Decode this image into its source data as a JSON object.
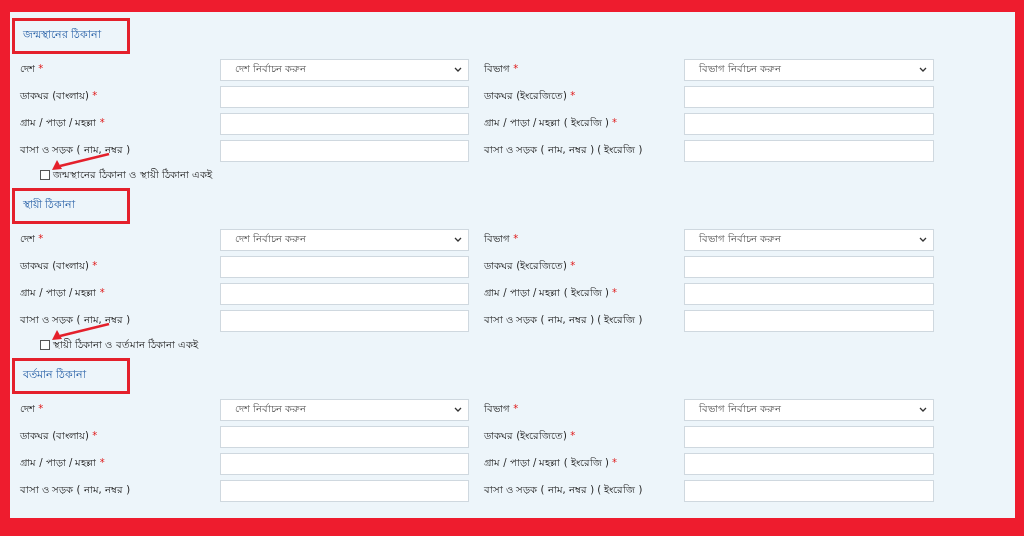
{
  "sections": [
    {
      "title": "জন্মস্থানের ঠিকানা",
      "highlighted": true,
      "rows": [
        [
          {
            "label": "দেশ",
            "mark": "*",
            "kind": "select",
            "placeholder": "দেশ নির্বাচন করুন"
          },
          {
            "label": "বিভাগ",
            "mark": "*",
            "kind": "select",
            "placeholder": "বিভাগ নির্বাচন করুন"
          }
        ],
        [
          {
            "label": "ডাকঘর (বাংলায়)",
            "mark": "*",
            "kind": "text"
          },
          {
            "label": "ডাকঘর (ইংরেজিতে)",
            "mark": "*",
            "kind": "text"
          }
        ],
        [
          {
            "label": "গ্রাম / পাড়া / মহল্লা",
            "mark": "*",
            "kind": "text"
          },
          {
            "label": "গ্রাম / পাড়া / মহল্লা ( ইংরেজি )",
            "mark": "*",
            "kind": "text"
          }
        ],
        [
          {
            "label": "বাসা ও সড়ক ( নাম, নম্বর )",
            "kind": "text"
          },
          {
            "label": "বাসা ও সড়ক ( নাম, নম্বর ) ( ইংরেজি )",
            "kind": "text"
          }
        ]
      ],
      "checkbox": {
        "label": "জন্মস্থানের ঠিকানা ও স্থায়ী ঠিকানা একই",
        "checked": false,
        "arrow": true
      }
    },
    {
      "title": "স্থায়ী ঠিকানা",
      "highlighted": true,
      "rows": [
        [
          {
            "label": "দেশ",
            "mark": "*",
            "kind": "select",
            "placeholder": "দেশ নির্বাচন করুন"
          },
          {
            "label": "বিভাগ",
            "mark": "*",
            "kind": "select",
            "placeholder": "বিভাগ নির্বাচন করুন"
          }
        ],
        [
          {
            "label": "ডাকঘর (বাংলায়)",
            "mark": "*",
            "kind": "text"
          },
          {
            "label": "ডাকঘর (ইংরেজিতে)",
            "mark": "*",
            "kind": "text"
          }
        ],
        [
          {
            "label": "গ্রাম / পাড়া / মহল্লা",
            "mark": "*",
            "kind": "text"
          },
          {
            "label": "গ্রাম / পাড়া / মহল্লা ( ইংরেজি )",
            "mark": "*",
            "kind": "text"
          }
        ],
        [
          {
            "label": "বাসা ও সড়ক ( নাম, নম্বর )",
            "kind": "text"
          },
          {
            "label": "বাসা ও সড়ক ( নাম, নম্বর ) ( ইংরেজি )",
            "kind": "text"
          }
        ]
      ],
      "checkbox": {
        "label": "স্থায়ী ঠিকানা ও বর্তমান ঠিকানা একই",
        "checked": false,
        "arrow": true
      }
    },
    {
      "title": "বর্তমান ঠিকানা",
      "highlighted": true,
      "rows": [
        [
          {
            "label": "দেশ",
            "mark": "*",
            "kind": "select",
            "placeholder": "দেশ নির্বাচন করুন"
          },
          {
            "label": "বিভাগ",
            "mark": "*",
            "kind": "select",
            "placeholder": "বিভাগ নির্বাচন করুন"
          }
        ],
        [
          {
            "label": "ডাকঘর (বাংলায়)",
            "mark": "*",
            "kind": "text"
          },
          {
            "label": "ডাকঘর (ইংরেজিতে)",
            "mark": "*",
            "kind": "text"
          }
        ],
        [
          {
            "label": "গ্রাম / পাড়া / মহল্লা",
            "mark": "*",
            "kind": "text"
          },
          {
            "label": "গ্রাম / পাড়া / মহল্লা ( ইংরেজি )",
            "mark": "*",
            "kind": "text"
          }
        ],
        [
          {
            "label": "বাসা ও সড়ক ( নাম, নম্বর )",
            "kind": "text"
          },
          {
            "label": "বাসা ও সড়ক ( নাম, নম্বর ) ( ইংরেজি )",
            "kind": "text"
          }
        ]
      ]
    }
  ]
}
